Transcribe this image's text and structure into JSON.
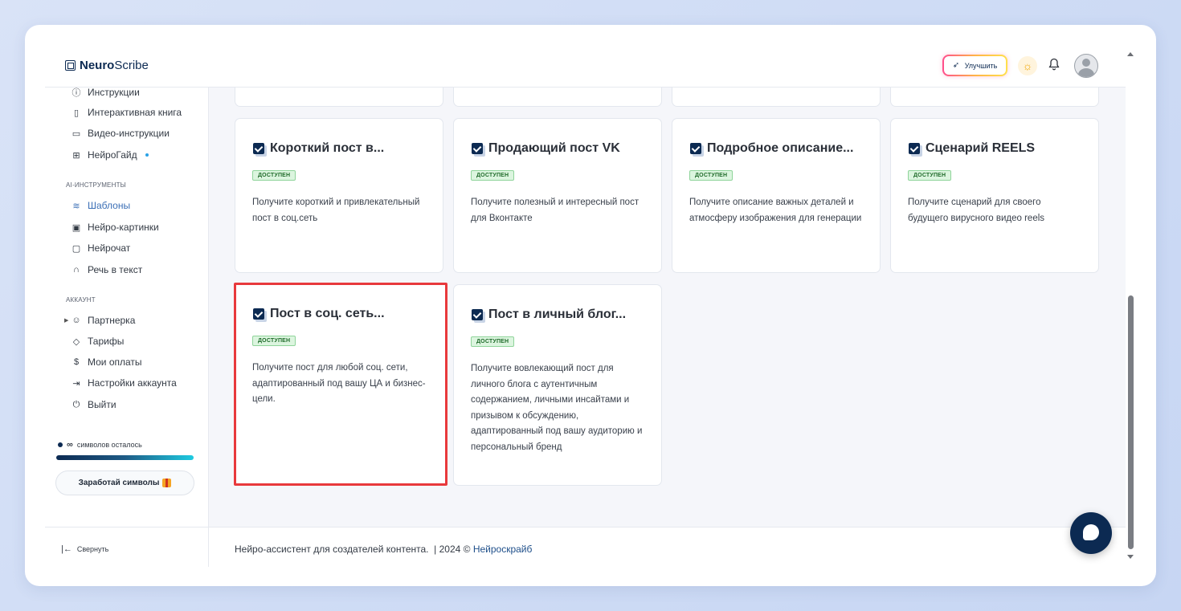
{
  "header": {
    "logo_bold": "Neuro",
    "logo_light": "Scribe",
    "upgrade_label": "Улучшить"
  },
  "sidebar": {
    "top_items": [
      {
        "label": "Инструкции",
        "icon": "question-circle-icon"
      },
      {
        "label": "Интерактивная книга",
        "icon": "book-icon"
      },
      {
        "label": "Видео-инструкции",
        "icon": "video-icon"
      },
      {
        "label": "НейроГайд",
        "icon": "layout-icon"
      }
    ],
    "ai_section": "AI-ИНСТРУМЕНТЫ",
    "ai_items": [
      {
        "label": "Шаблоны",
        "icon": "layers-icon"
      },
      {
        "label": "Нейро-картинки",
        "icon": "image-icon"
      },
      {
        "label": "Нейрочат",
        "icon": "chat-icon"
      },
      {
        "label": "Речь в текст",
        "icon": "headphones-icon"
      }
    ],
    "account_section": "АККАУНТ",
    "account_items": [
      {
        "label": "Партнерка",
        "icon": "users-icon"
      },
      {
        "label": "Тарифы",
        "icon": "tag-icon"
      },
      {
        "label": "Мои оплаты",
        "icon": "dollar-icon"
      },
      {
        "label": "Настройки аккаунта",
        "icon": "login-icon"
      },
      {
        "label": "Выйти",
        "icon": "power-icon"
      }
    ],
    "symbols_value": "∞",
    "symbols_label": "символов осталось",
    "earn_label": "Заработай символы",
    "collapse_label": "Свернуть"
  },
  "cards": [
    {
      "title": "Короткий пост в...",
      "badge": "ДОСТУПЕН",
      "desc": "Получите короткий и привлекательный пост в соц.сеть"
    },
    {
      "title": "Продающий пост VK",
      "badge": "ДОСТУПЕН",
      "desc": "Получите полезный и интересный пост для Вконтакте"
    },
    {
      "title": "Подробное описание...",
      "badge": "ДОСТУПЕН",
      "desc": "Получите описание важных деталей и атмосферу изображения для генерации"
    },
    {
      "title": "Сценарий REELS",
      "badge": "ДОСТУПЕН",
      "desc": "Получите сценарий для своего будущего вирусного видео reels"
    },
    {
      "title": "Пост в соц. сеть...",
      "badge": "ДОСТУПЕН",
      "desc": "Получите пост для любой соц. сети, адаптированный под вашу ЦА и бизнес-цели."
    },
    {
      "title": "Пост в личный блог...",
      "badge": "ДОСТУПЕН",
      "desc": "Получите вовлекающий пост для личного блога с аутентичным содержанием, личными инсайтами и призывом к обсуждению, адаптированный под вашу аудиторию и персональный бренд"
    }
  ],
  "footer": {
    "text": "Нейро-ассистент для создателей контента.  | 2024 © ",
    "link": "Нейроскрайб"
  },
  "colors": {
    "accent": "#0c2a52",
    "highlight": "#e8393c",
    "badge_bg": "#dcf5df"
  }
}
